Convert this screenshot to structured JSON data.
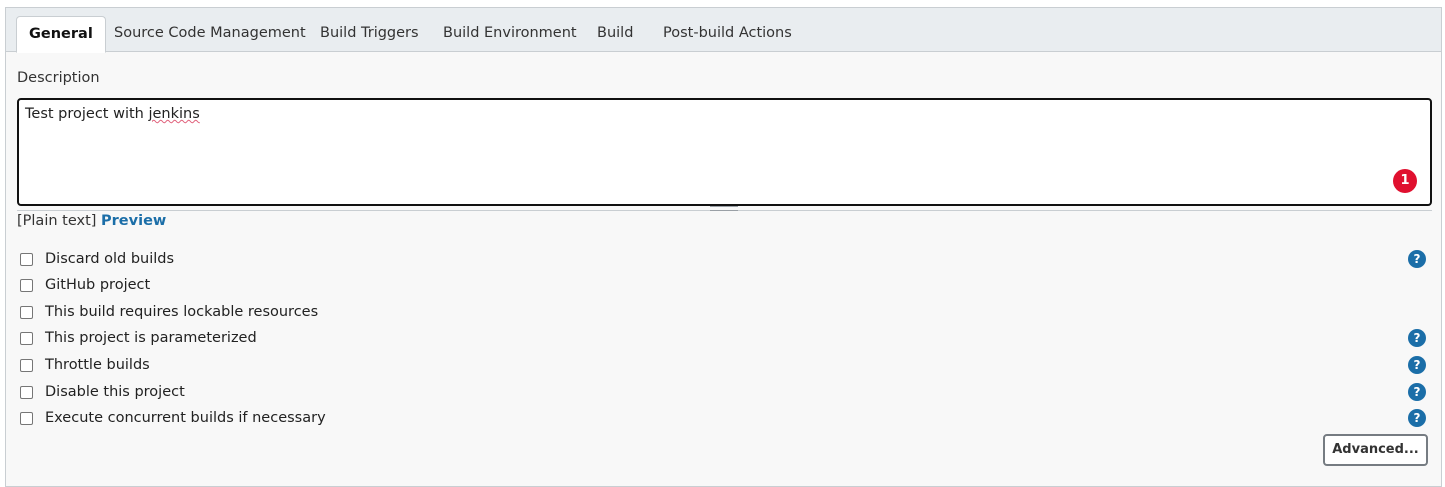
{
  "tabs": [
    {
      "label": "General"
    },
    {
      "label": "Source Code Management"
    },
    {
      "label": "Build Triggers"
    },
    {
      "label": "Build Environment"
    },
    {
      "label": "Build"
    },
    {
      "label": "Post-build Actions"
    }
  ],
  "description": {
    "label": "Description",
    "value_prefix": "Test project with ",
    "value_misspelled": "jenkins",
    "badge_count": "1"
  },
  "format": {
    "plain_text": "[Plain text]",
    "preview": "Preview"
  },
  "options": [
    {
      "label": "Discard old builds",
      "checked": false,
      "help": true
    },
    {
      "label": "GitHub project",
      "checked": false,
      "help": false
    },
    {
      "label": "This build requires lockable resources",
      "checked": false,
      "help": false
    },
    {
      "label": "This project is parameterized",
      "checked": false,
      "help": true
    },
    {
      "label": "Throttle builds",
      "checked": false,
      "help": true
    },
    {
      "label": "Disable this project",
      "checked": false,
      "help": true
    },
    {
      "label": "Execute concurrent builds if necessary",
      "checked": false,
      "help": true
    }
  ],
  "help_icon_glyph": "?",
  "advanced_button": "Advanced...",
  "colors": {
    "accent": "#1b6ea8",
    "badge": "#e0102f"
  }
}
